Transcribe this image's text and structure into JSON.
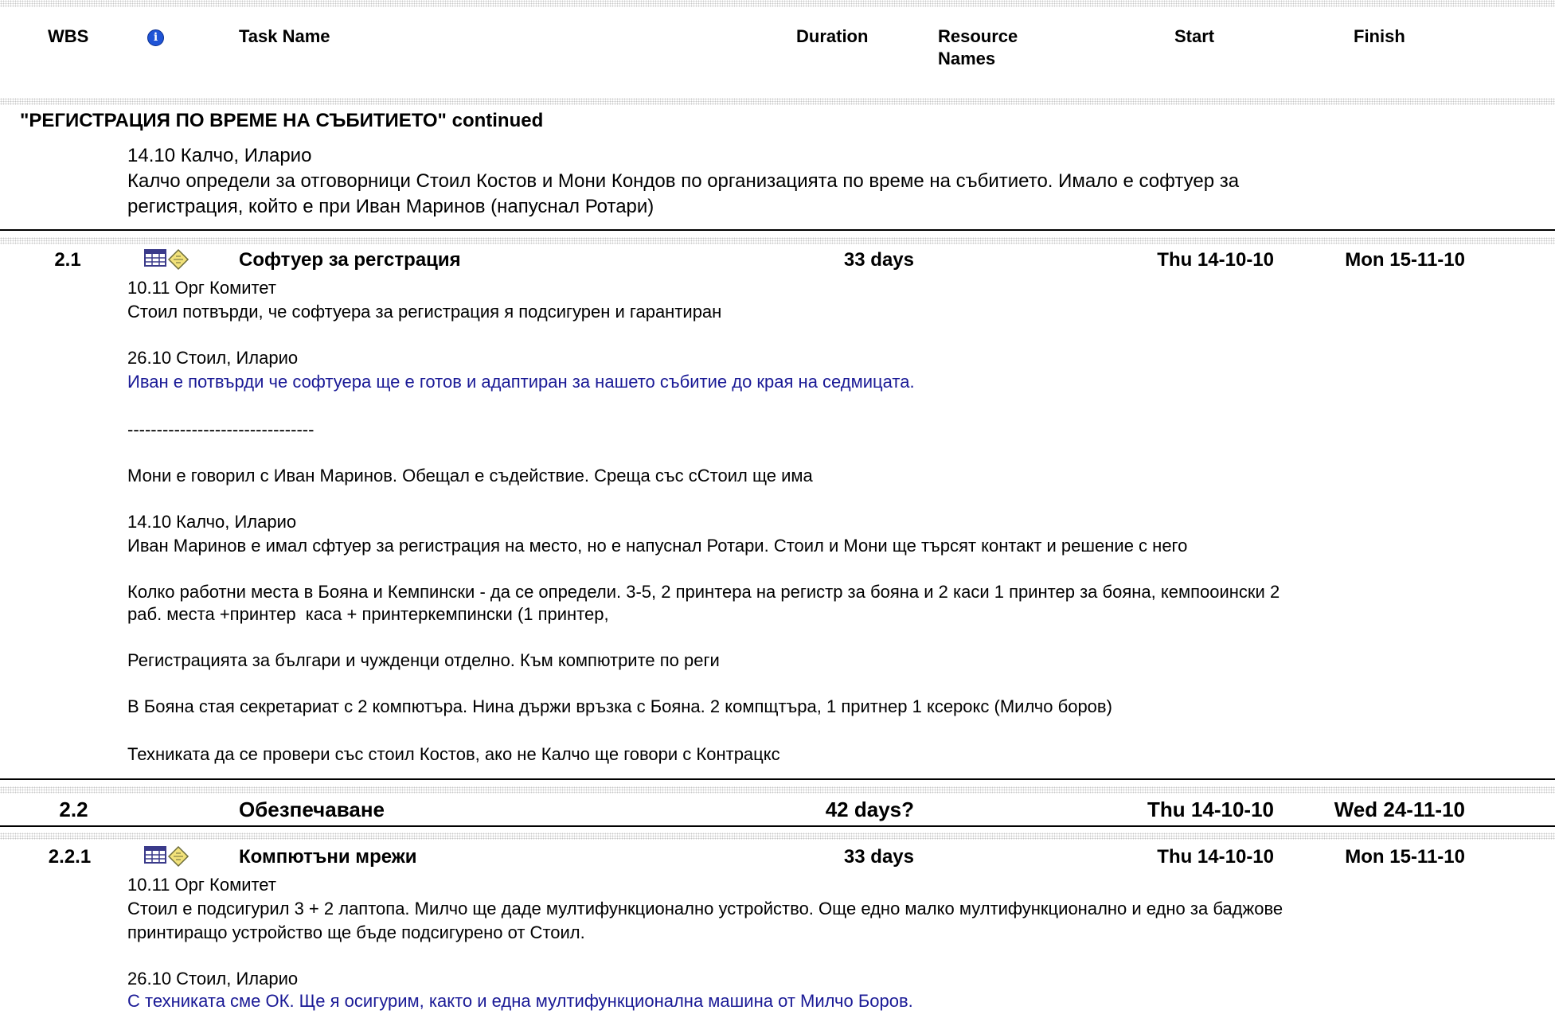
{
  "header": {
    "wbs": "WBS",
    "info_icon": "info-icon",
    "task_name": "Task Name",
    "duration": "Duration",
    "resource_line1": "Resource",
    "resource_line2": "Names",
    "start": "Start",
    "finish": "Finish"
  },
  "continued": {
    "title": "\"РЕГИСТРАЦИЯ ПО ВРЕМЕ НА СЪБИТИЕТО\" continued",
    "note_date": "14.10 Калчо, Иларио",
    "note_text": "Калчо определи за отговорници Стоил Костов и Мони Кондов по организацията по време на събитието. Имало е софтуер за",
    "note_text2": "регистрация, който е при Иван Маринов (напуснал Ротари)"
  },
  "task_2_1": {
    "wbs": "2.1",
    "name": "Софтуер за регстрация",
    "duration": "33 days",
    "start": "Thu 14-10-10",
    "finish": "Mon 15-11-10",
    "notes": [
      "10.11 Орг Комитет",
      "Стоил потвърди, че софтуера за регистрация я подсигурен и гарантиран",
      "26.10 Стоил, Иларио",
      "Иван е потвърди че софтуера ще е готов и адаптиран за нашето събитие до края на седмицата.",
      "--------------------------------",
      "Мони е говорил с Иван Маринов. Обещал е съдействие. Среща със сСтоил ще има",
      "14.10 Калчо, Иларио",
      "Иван Маринов е имал сфтуер за регистрация на место, но е напуснал Ротари. Стоил и Мони ще търсят контакт и решение с него",
      "Колко работни места в Бояна и Кемпински - да се определи. 3-5, 2 принтера на регистр за бояна и 2 каси 1 принтер за бояна, кемпооински 2",
      "раб. места +принтер  каса + принтеркемпински (1 принтер,",
      "Регистрацията за българи и чужденци отделно. Към компютрите по реги",
      "В Бояна стая секретариат с 2 компютъра. Нина държи връзка с Бояна. 2 компщтъра, 1 притнер 1 ксерокс (Милчо боров)",
      "Техниката да се провери със стоил Костов, ако не Калчо ще говори с Контрацкс"
    ]
  },
  "task_2_2": {
    "wbs": "2.2",
    "name": "Обезпечаване",
    "duration": "42 days?",
    "start": "Thu 14-10-10",
    "finish": "Wed 24-11-10"
  },
  "task_2_2_1": {
    "wbs": "2.2.1",
    "name": "Компютъни мрежи",
    "duration": "33 days",
    "start": "Thu 14-10-10",
    "finish": "Mon 15-11-10",
    "notes": [
      "10.11 Орг Комитет",
      "Стоил е подсигурил 3 + 2 лаптопа. Милчо ще даде мултифункционално устройство. Още едно малко мултифункционално и едно за баджове",
      "принтиращо устройство ще бъде подсигурено от Стоил.",
      "26.10 Стоил, Иларио",
      "С техниката сме ОК. Ще я осигурим, както и една мултифункционална машина от Милчо Боров."
    ]
  },
  "icons": {
    "task_indicator": "notes-indicator-icon"
  },
  "colors": {
    "note_blue": "#1a1a96",
    "separator_dots": "#c8c8c8"
  }
}
